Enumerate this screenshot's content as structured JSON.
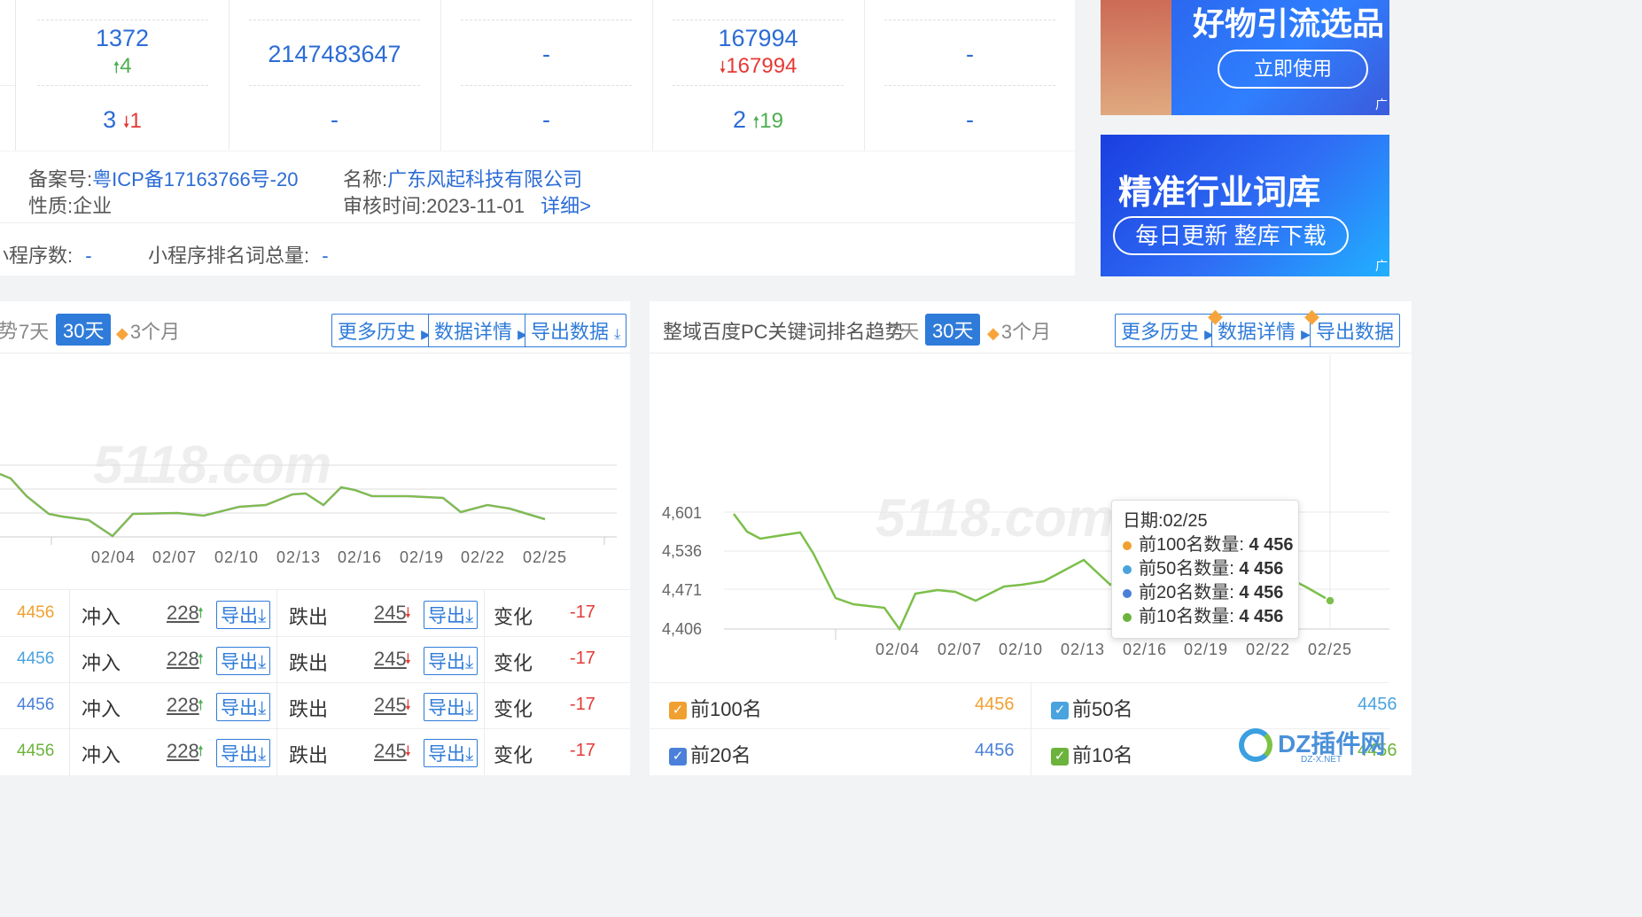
{
  "stats": {
    "row1": [
      {
        "value": "1372",
        "change": "4",
        "dir": "up"
      },
      {
        "value": "2147483647"
      },
      {
        "value": "-"
      },
      {
        "value": "167994",
        "change": "167994",
        "dir": "down"
      },
      {
        "value": "-"
      }
    ],
    "row2": [
      {
        "value": "3",
        "change": "1",
        "dir": "down"
      },
      {
        "value": "-"
      },
      {
        "value": "-"
      },
      {
        "value": "2",
        "change": "19",
        "dir": "up"
      },
      {
        "value": "-"
      }
    ]
  },
  "icp": {
    "record_label": "备案号:",
    "record_value": "粤ICP备17163766号-20",
    "name_label": "名称:",
    "name_value": "广东风起科技有限公司",
    "nature_label": "性质:",
    "nature_value": "企业",
    "audit_label": "审核时间:",
    "audit_value": "2023-11-01",
    "detail_link": "详细>"
  },
  "miniprogram": {
    "count_label": "小程序数:",
    "count_value": "-",
    "rank_label": "小程序排名词总量:",
    "rank_value": "-"
  },
  "ads": {
    "ad1_title": "好物引流选品",
    "ad1_button": "立即使用",
    "ad2_title": "精准行业词库",
    "ad2_subtitle": "每日更新 整库下载",
    "corner": "广"
  },
  "left_panel": {
    "tabs": [
      "7天",
      "30天",
      "3个月"
    ],
    "buttons": [
      "更多历史",
      "数据详情",
      "导出数据"
    ],
    "x_ticks": [
      "02/04",
      "02/07",
      "02/10",
      "02/13",
      "02/16",
      "02/19",
      "02/22",
      "02/25"
    ],
    "watermark": "5118.com",
    "rows": [
      {
        "value": "4456",
        "value_color": "#f0a030",
        "in_label": "冲入",
        "in_value": "228",
        "export": "导出",
        "out_label": "跌出",
        "out_value": "245",
        "change_label": "变化",
        "change_value": "-17"
      },
      {
        "value": "4456",
        "value_color": "#4aa3df",
        "in_label": "冲入",
        "in_value": "228",
        "export": "导出",
        "out_label": "跌出",
        "out_value": "245",
        "change_label": "变化",
        "change_value": "-17"
      },
      {
        "value": "4456",
        "value_color": "#4a80d9",
        "in_label": "冲入",
        "in_value": "228",
        "export": "导出",
        "out_label": "跌出",
        "out_value": "245",
        "change_label": "变化",
        "change_value": "-17"
      },
      {
        "value": "4456",
        "value_color": "#6cb33e",
        "in_label": "冲入",
        "in_value": "228",
        "export": "导出",
        "out_label": "跌出",
        "out_value": "245",
        "change_label": "变化",
        "change_value": "-17"
      }
    ]
  },
  "right_panel": {
    "title": "整域百度PC关键词排名趋势",
    "tabs": [
      "7天",
      "30天",
      "3个月"
    ],
    "buttons": [
      "更多历史",
      "数据详情",
      "导出数据"
    ],
    "legend": [
      {
        "label": "前100名",
        "value": "4456",
        "color": "#f0a030"
      },
      {
        "label": "前50名",
        "value": "4456",
        "color": "#4aa3df"
      },
      {
        "label": "前20名",
        "value": "4456",
        "color": "#4a80d9"
      },
      {
        "label": "前10名",
        "value": "4456",
        "color": "#6cb33e"
      }
    ],
    "tooltip": {
      "date": "日期:02/25",
      "lines": [
        {
          "label": "前100名数量:",
          "value": "4 456",
          "color": "#f0a030"
        },
        {
          "label": "前50名数量:",
          "value": "4 456",
          "color": "#4aa3df"
        },
        {
          "label": "前20名数量:",
          "value": "4 456",
          "color": "#4a80d9"
        },
        {
          "label": "前10名数量:",
          "value": "4 456",
          "color": "#6cb33e"
        }
      ]
    }
  },
  "chart_data": {
    "type": "line",
    "x": [
      "02/04",
      "02/07",
      "02/10",
      "02/13",
      "02/16",
      "02/19",
      "02/22",
      "02/25"
    ],
    "y_ticks": [
      "4,601",
      "4,536",
      "4,471",
      "4,406"
    ],
    "ylim": [
      4406,
      4601
    ],
    "series": [
      {
        "name": "前10名数量",
        "color": "#7cbf4a",
        "values": [
          4406,
          4470,
          4468,
          4520,
          4510,
          4475,
          4480,
          4456
        ]
      }
    ]
  },
  "watermark_logo": "DZ插件网",
  "watermark_sub": "DZ-X.NET"
}
